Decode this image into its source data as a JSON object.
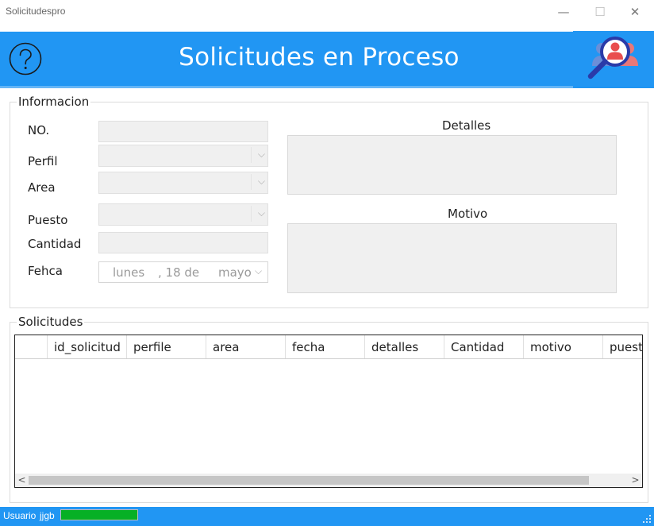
{
  "window": {
    "title": "Solicitudespro",
    "minimize_glyph": "—",
    "maximize_glyph": "☐",
    "close_glyph": "✕"
  },
  "header": {
    "title": "Solicitudes en Proceso",
    "help_icon": "help-circle-icon",
    "brand_icon": "search-user-icon",
    "color": "#2196f3"
  },
  "info": {
    "legend": "Informacion",
    "no_label": "NO.",
    "perfil_label": "Perfil",
    "area_label": "Area",
    "puesto_label": "Puesto",
    "cantidad_label": "Cantidad",
    "fecha_label": "Fehca",
    "no_value": "",
    "perfil_value": "",
    "area_value": "",
    "puesto_value": "",
    "cantidad_value": "",
    "date": {
      "weekday": "lunes",
      "day": ", 18 de",
      "month": "mayo",
      "dropdown_glyph": "⌵"
    },
    "detalles_label": "Detalles",
    "motivo_label": "Motivo",
    "detalles_value": "",
    "motivo_value": ""
  },
  "solicitudes": {
    "legend": "Solicitudes",
    "columns": [
      "id_solicitud",
      "perfile",
      "area",
      "fecha",
      "detalles",
      "Cantidad",
      "motivo",
      "puesto"
    ],
    "rows": [],
    "scroll_left_glyph": "<",
    "scroll_right_glyph": ">"
  },
  "status": {
    "user_label": "Usuario",
    "username": "jjgb",
    "progress": 1.0,
    "progress_color": "#06b025"
  }
}
